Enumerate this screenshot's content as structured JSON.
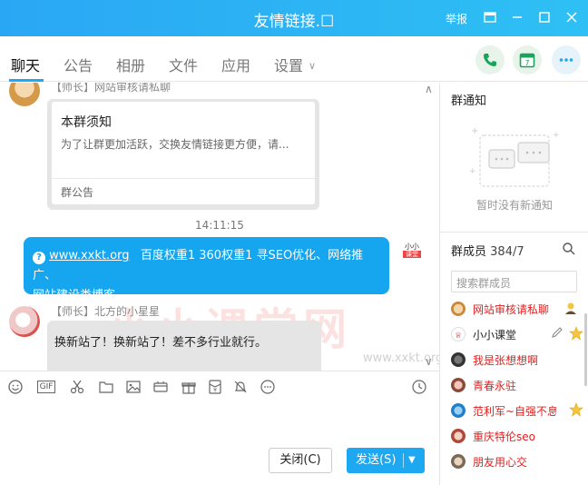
{
  "window": {
    "title": "友情链接.☐",
    "report_label": "举报"
  },
  "tabs": [
    {
      "label": "聊天"
    },
    {
      "label": "公告"
    },
    {
      "label": "相册"
    },
    {
      "label": "文件"
    },
    {
      "label": "应用"
    },
    {
      "label": "设置"
    }
  ],
  "chat": {
    "first_sender": "【师长】网站审核请私聊",
    "notice_card": {
      "title": "本群须知",
      "body": "为了让群更加活跃，交换友情链接更方便，请...",
      "footer": "群公告"
    },
    "timestamp": "14:11:15",
    "blue_message": {
      "link": "www.xxkt.org",
      "text_line1": "百度权重1 360权重1  寻SEO优化、网络推广、",
      "text_line2": "网站建设类博客"
    },
    "second_sender": "【师长】北方的小星星",
    "grey_message": "换新站了！换新站了！差不多行业就行。",
    "watermark": "小小课堂网",
    "watermark_url": "www.xxkt.org",
    "logo_top": "小小",
    "logo_bottom": "课堂"
  },
  "toolbar": {
    "gif_label": "GIF"
  },
  "buttons": {
    "close_label": "关闭(C)",
    "send_label": "发送(S)"
  },
  "right_panel": {
    "notice_title": "群通知",
    "empty_notice": "暂时没有新通知",
    "members_title": "群成员",
    "members_count": "384/7",
    "search_placeholder": "搜索群成员",
    "members": [
      {
        "name": "网站审核请私聊",
        "color": "#e02020"
      },
      {
        "name": "小小课堂",
        "color": "#222222"
      },
      {
        "name": "我是张想想啊",
        "color": "#e02020"
      },
      {
        "name": "青春永驻",
        "color": "#e02020"
      },
      {
        "name": "范利军~自强不息",
        "color": "#e02020"
      },
      {
        "name": "重庆特伦seo",
        "color": "#e02020"
      },
      {
        "name": "朋友用心交",
        "color": "#e02020"
      }
    ]
  },
  "colors": {
    "accent": "#1fa8f2",
    "bubble_blue": "#15a6ef",
    "bubble_grey": "#e5e5e5"
  }
}
